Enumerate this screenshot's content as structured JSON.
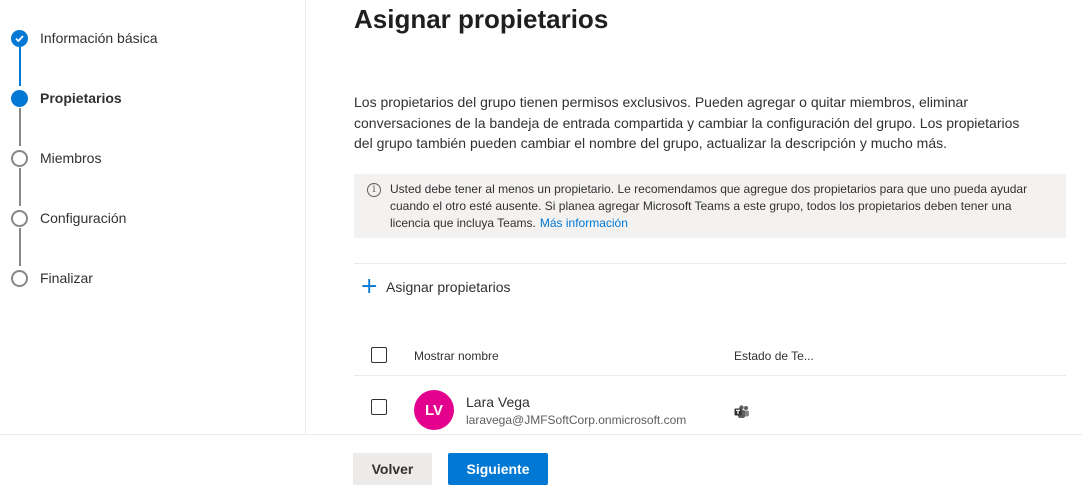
{
  "wizard": {
    "steps": [
      {
        "label": "Información básica",
        "state": "done"
      },
      {
        "label": "Propietarios",
        "state": "current"
      },
      {
        "label": "Miembros",
        "state": "todo"
      },
      {
        "label": "Configuración",
        "state": "todo"
      },
      {
        "label": "Finalizar",
        "state": "todo"
      }
    ]
  },
  "main": {
    "title": "Asignar propietarios",
    "description": "Los propietarios del grupo tienen permisos exclusivos. Pueden agregar o quitar miembros, eliminar conversaciones de la bandeja de entrada compartida y cambiar la configuración del grupo. Los propietarios del grupo también pueden cambiar el nombre del grupo, actualizar la descripción y mucho más.",
    "info": {
      "text": "Usted debe tener al menos un propietario. Le recomendamos que agregue dos propietarios para que uno pueda ayudar cuando el otro esté ausente. Si planea agregar Microsoft Teams a este grupo, todos los propietarios deben tener una licencia que incluya Teams.",
      "link": "Más información",
      "icon": "info-icon"
    },
    "add_owner_label": "Asignar propietarios",
    "add_owner_icon": "plus-icon",
    "table": {
      "columns": [
        "Mostrar nombre",
        "Estado de Te..."
      ],
      "rows": [
        {
          "initials": "LV",
          "name": "Lara Vega",
          "email": "laravega@JMFSoftCorp.onmicrosoft.com",
          "status_icon": "teams-icon",
          "avatar_color": "#e3008c"
        }
      ]
    }
  },
  "footer": {
    "back_label": "Volver",
    "next_label": "Siguiente"
  },
  "colors": {
    "accent": "#0078d4",
    "info_background": "#f3f2f1"
  }
}
